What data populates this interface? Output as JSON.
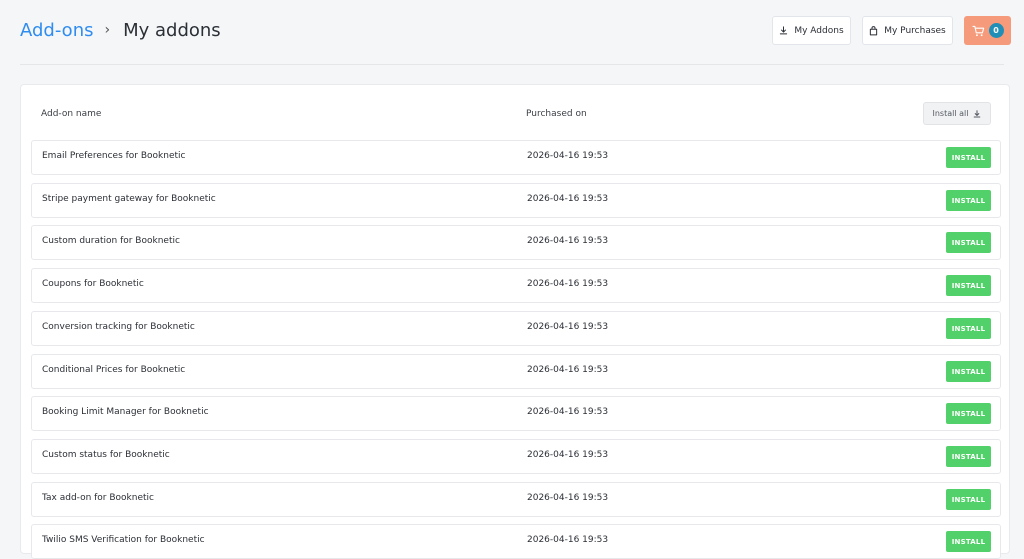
{
  "breadcrumb": {
    "parent": "Add-ons",
    "separator": "›",
    "current": "My addons"
  },
  "header": {
    "my_addons_label": "My Addons",
    "my_purchases_label": "My Purchases",
    "cart_count": "0"
  },
  "table": {
    "col_name": "Add-on name",
    "col_purchased": "Purchased on",
    "install_all_label": "Install all",
    "install_label": "INSTALL",
    "rows": [
      {
        "name": "Email Preferences for Booknetic",
        "date": "2026-04-16 19:53"
      },
      {
        "name": "Stripe payment gateway for Booknetic",
        "date": "2026-04-16 19:53"
      },
      {
        "name": "Custom duration for Booknetic",
        "date": "2026-04-16 19:53"
      },
      {
        "name": "Coupons for Booknetic",
        "date": "2026-04-16 19:53"
      },
      {
        "name": "Conversion tracking for Booknetic",
        "date": "2026-04-16 19:53"
      },
      {
        "name": "Conditional Prices for Booknetic",
        "date": "2026-04-16 19:53"
      },
      {
        "name": "Booking Limit Manager for Booknetic",
        "date": "2026-04-16 19:53"
      },
      {
        "name": "Custom status for Booknetic",
        "date": "2026-04-16 19:53"
      },
      {
        "name": "Tax add-on for Booknetic",
        "date": "2026-04-16 19:53"
      },
      {
        "name": "Twilio SMS Verification for Booknetic",
        "date": "2026-04-16 19:53"
      }
    ]
  },
  "colors": {
    "link": "#2f8cf0",
    "install_button": "#52d16a",
    "cart_button": "#f59a7a",
    "cart_badge": "#1f8fb8"
  },
  "icons": {
    "my_addons": "download-icon",
    "my_purchases": "shopping-bag-icon",
    "cart": "cart-icon",
    "install_all": "download-icon"
  }
}
